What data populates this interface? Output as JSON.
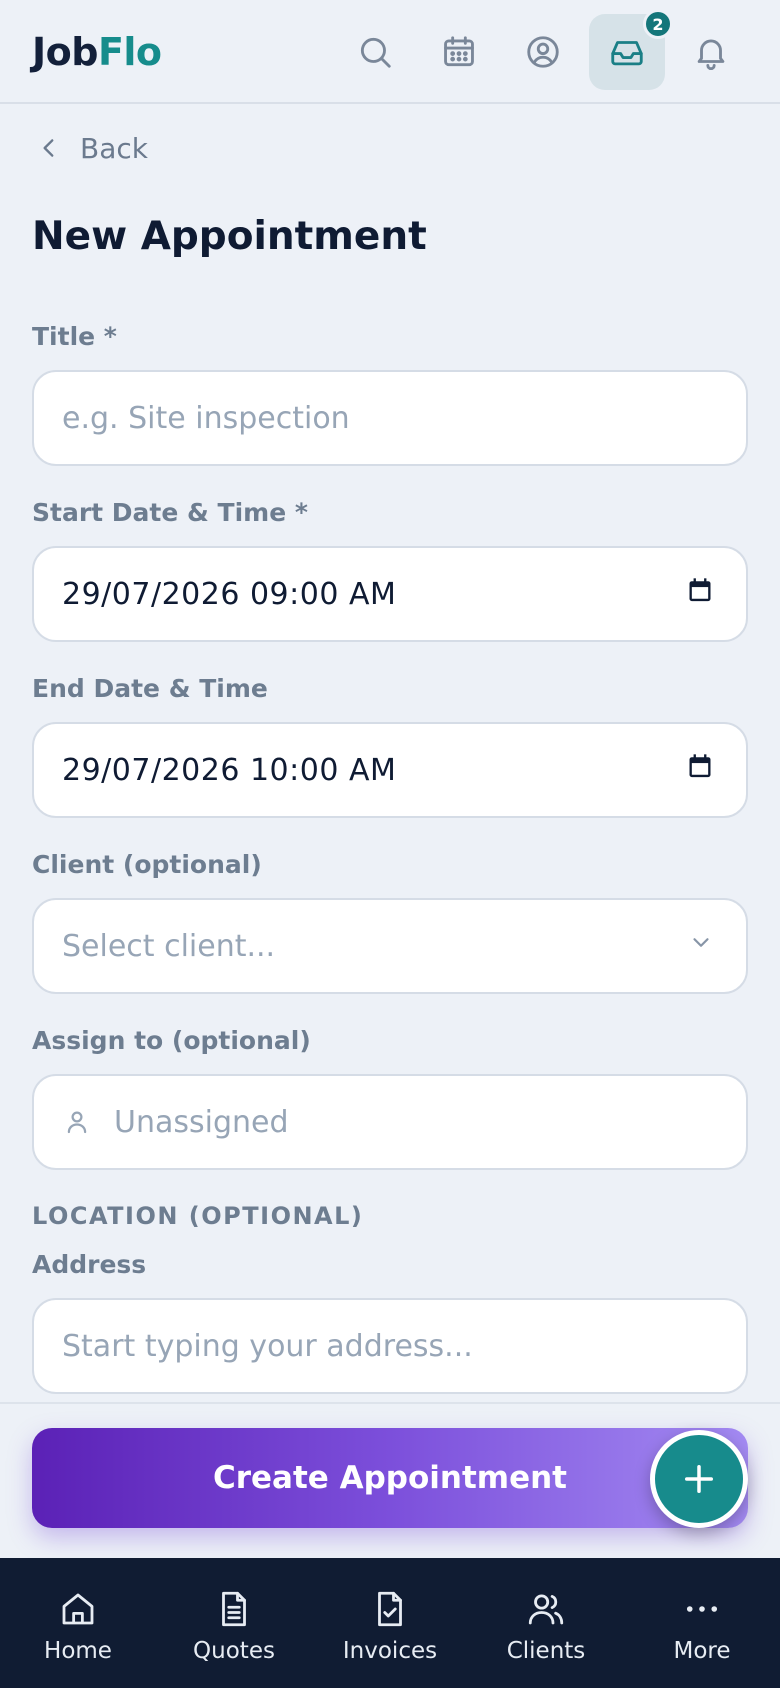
{
  "app": {
    "logo_part1": "Job",
    "logo_part2": "Flo",
    "brand_color": "#168c8c",
    "accent_purple": "#7c4fdb"
  },
  "header": {
    "icons": [
      "search-icon",
      "calendar-icon",
      "user-circle-icon",
      "inbox-icon",
      "bell-icon"
    ],
    "inbox_badge": "2"
  },
  "back_label": "Back",
  "page_title": "New Appointment",
  "form": {
    "title_label": "Title *",
    "title_placeholder": "e.g. Site inspection",
    "start_label": "Start Date & Time *",
    "start_value": "29/07/2026 09:00 AM",
    "end_label": "End Date & Time",
    "end_value": "29/07/2026 10:00 AM",
    "client_label": "Client (optional)",
    "client_placeholder": "Select client...",
    "assign_label": "Assign to (optional)",
    "assign_placeholder": "Unassigned",
    "location_section": "LOCATION (OPTIONAL)",
    "address_label": "Address",
    "address_placeholder": "Start typing your address..."
  },
  "create_button": "Create Appointment",
  "bottom_nav": [
    {
      "label": "Home",
      "icon": "home-icon"
    },
    {
      "label": "Quotes",
      "icon": "document-icon"
    },
    {
      "label": "Invoices",
      "icon": "invoice-check-icon"
    },
    {
      "label": "Clients",
      "icon": "users-icon"
    },
    {
      "label": "More",
      "icon": "more-dots-icon"
    }
  ]
}
